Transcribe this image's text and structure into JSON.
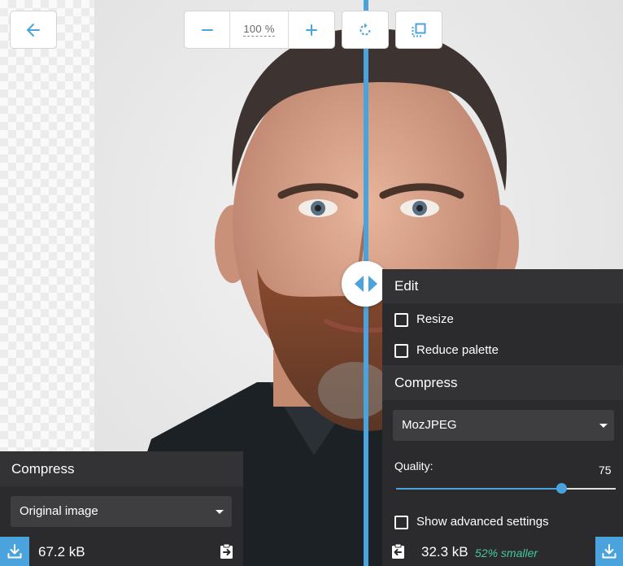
{
  "toolbar": {
    "back_icon": "arrow-left-icon",
    "zoom_out_icon": "minus-icon",
    "zoom_in_icon": "plus-icon",
    "zoom_value": "100 %",
    "rotate_icon": "rotate-icon",
    "background_toggle_icon": "toggle-background-icon"
  },
  "left_panel": {
    "section_title": "Compress",
    "method_select_value": "Original image",
    "file_size": "67.2 kB",
    "download_icon": "download-icon",
    "copy_settings_icon": "copy-settings-right-icon"
  },
  "right_panel": {
    "edit_title": "Edit",
    "resize_label": "Resize",
    "reduce_palette_label": "Reduce palette",
    "compress_title": "Compress",
    "method_select_value": "MozJPEG",
    "quality_label": "Quality:",
    "quality_value": "75",
    "quality_fraction": 0.75,
    "advanced_label": "Show advanced settings",
    "file_size": "32.3 kB",
    "savings": "52% smaller",
    "download_icon": "download-icon",
    "copy_settings_icon": "copy-settings-left-icon"
  },
  "colors": {
    "accent": "#4aa3dc",
    "panel_dark": "#2b2b2d",
    "panel_header": "#333335",
    "savings_green": "#44c8a0"
  }
}
